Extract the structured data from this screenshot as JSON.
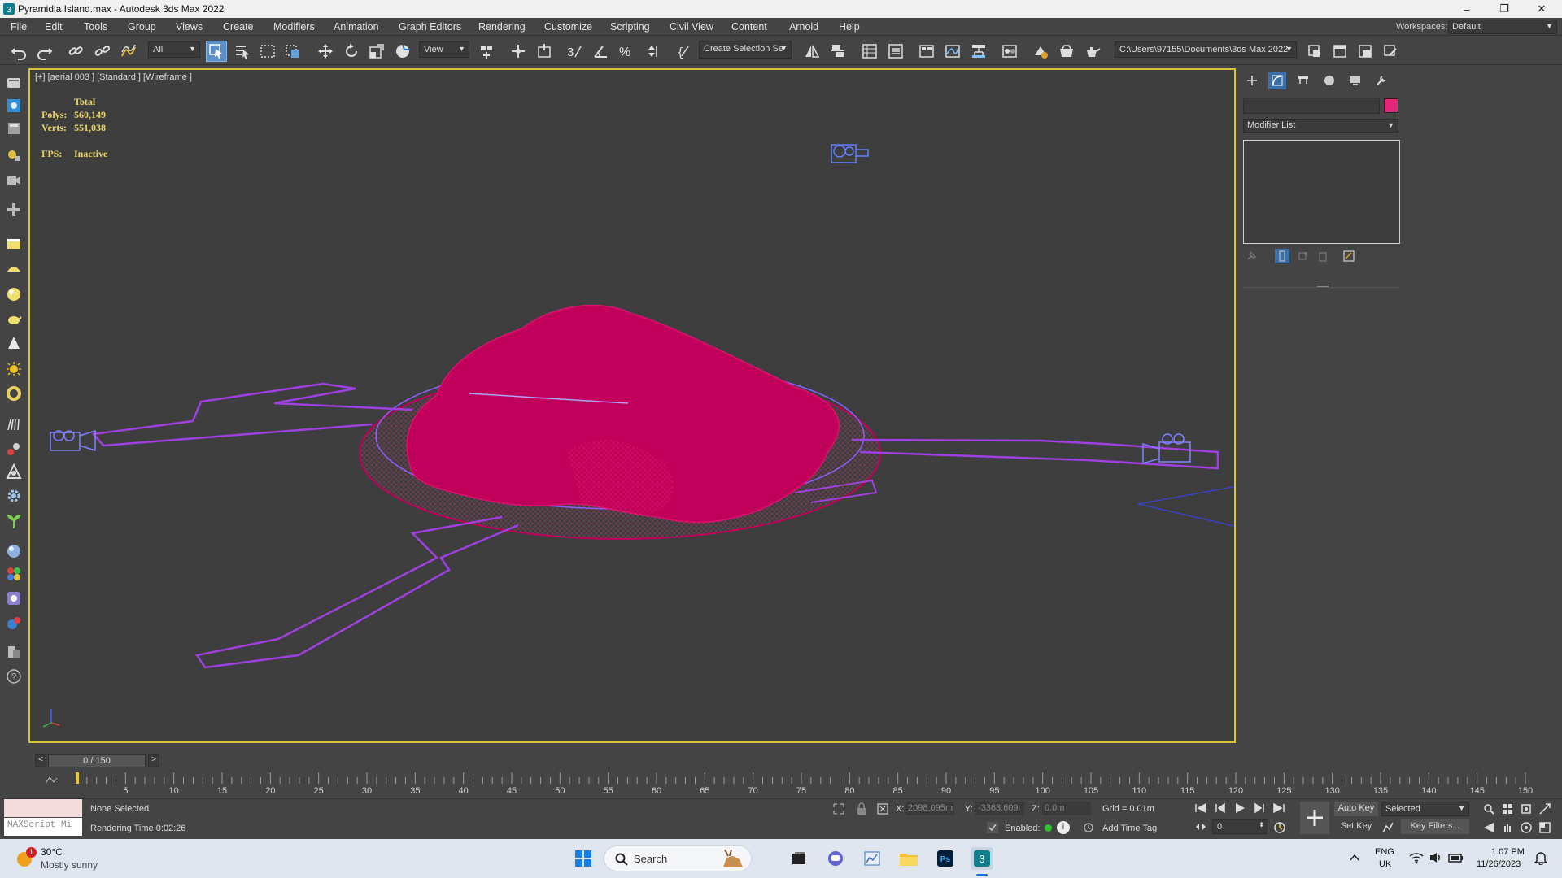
{
  "window": {
    "title": "Pyramidia Island.max - Autodesk 3ds Max 2022",
    "minimize": "–",
    "maximize": "❐",
    "close": "✕"
  },
  "menu": {
    "items": [
      "File",
      "Edit",
      "Tools",
      "Group",
      "Views",
      "Create",
      "Modifiers",
      "Animation",
      "Graph Editors",
      "Rendering",
      "Customize",
      "Scripting",
      "Civil View",
      "Content",
      "Arnold",
      "Help"
    ],
    "workspaces_label": "Workspaces:",
    "workspaces_value": "Default"
  },
  "toolbar": {
    "filter_value": "All",
    "ref_coord_value": "View",
    "selection_set_value": "Create Selection Se",
    "project_path": "C:\\Users\\97155\\Documents\\3ds Max 2022"
  },
  "viewport": {
    "label": "[+] [aerial 003 ] [Standard ] [Wireframe ]",
    "stats_total": "Total",
    "stats_polys_label": "Polys:",
    "stats_polys_value": "560,149",
    "stats_verts_label": "Verts:",
    "stats_verts_value": "551,038",
    "fps_label": "FPS:",
    "fps_value": "Inactive",
    "mesh_color": "#c0005a",
    "spline_color": "#a040e0"
  },
  "command_panel": {
    "modifier_list": "Modifier List",
    "color_swatch": "#e0287a"
  },
  "timeline": {
    "frame_display": "0 / 150",
    "ticks": [
      5,
      10,
      15,
      20,
      25,
      30,
      35,
      40,
      45,
      50,
      55,
      60,
      65,
      70,
      75,
      80,
      85,
      90,
      95,
      100,
      105,
      110,
      115,
      120,
      125,
      130,
      135,
      140,
      145,
      150
    ],
    "max_frame": 150
  },
  "status": {
    "maxscript_placeholder": "MAXScript Mi",
    "selection": "None Selected",
    "rendering_time": "Rendering Time  0:02:26",
    "x_label": "X:",
    "x_value": "2098.095m",
    "y_label": "Y:",
    "y_value": "-3363.609r",
    "z_label": "Z:",
    "z_value": "0.0m",
    "grid": "Grid = 0.01m",
    "enabled_label": "Enabled:",
    "add_time_tag": "Add Time Tag",
    "auto_key": "Auto Key",
    "set_key": "Set Key",
    "selected_value": "Selected",
    "key_filters": "Key Filters...",
    "frame_value": "0"
  },
  "taskbar": {
    "weather_temp": "30°C",
    "weather_desc": "Mostly sunny",
    "weather_badge": "1",
    "search_label": "Search",
    "lang_top": "ENG",
    "lang_bottom": "UK",
    "time": "1:07 PM",
    "date": "11/26/2023"
  }
}
